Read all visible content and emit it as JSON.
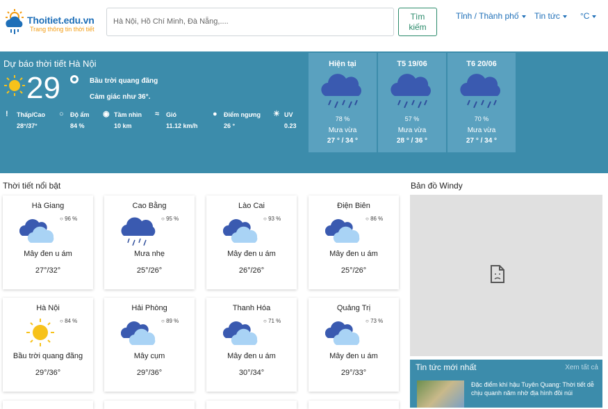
{
  "header": {
    "brand": "Thoitiet.edu.vn",
    "tagline": "Trang thông tin thời tiết",
    "search_placeholder": "Hà Nội, Hồ Chí Minh, Đà Nẵng,....",
    "search_button_line1": "Tìm",
    "search_button_line2": "kiếm",
    "nav_province": "Tỉnh / Thành phố",
    "nav_news": "Tin tức",
    "nav_unit": "°C"
  },
  "hero": {
    "title": "Dự báo thời tiết Hà Nội",
    "temp": "29",
    "desc": "Bầu trời quang đãng",
    "feel": "Cảm giác như 36°.",
    "stats": [
      {
        "label": "Thấp/Cao",
        "value": "28°/37°",
        "icon": "thermometer-icon"
      },
      {
        "label": "Độ ẩm",
        "value": "84 %",
        "icon": "droplet-icon"
      },
      {
        "label": "Tầm nhìn",
        "value": "10 km",
        "icon": "eye-icon"
      },
      {
        "label": "Gió",
        "value": "11.12 km/h",
        "icon": "wind-icon"
      },
      {
        "label": "Điểm ngưng",
        "value": "26 °",
        "icon": "dewpoint-icon"
      },
      {
        "label": "UV",
        "value": "0.23",
        "icon": "sun-small-icon"
      }
    ],
    "forecast": [
      {
        "day": "Hiện tại",
        "pct": "78 %",
        "desc": "Mưa vừa",
        "range": "27 ° / 34 °"
      },
      {
        "day": "T5 19/06",
        "pct": "57 %",
        "desc": "Mưa vừa",
        "range": "28 ° / 36 °"
      },
      {
        "day": "T6 20/06",
        "pct": "70 %",
        "desc": "Mưa vừa",
        "range": "27 ° / 34 °"
      }
    ]
  },
  "featured": {
    "title": "Thời tiết nổi bật",
    "cards": [
      {
        "city": "Hà Giang",
        "hum": "96 %",
        "desc": "Mây đen u ám",
        "range": "27°/32°",
        "icon": "overcast-icon"
      },
      {
        "city": "Cao Bằng",
        "hum": "95 %",
        "desc": "Mưa nhẹ",
        "range": "25°/26°",
        "icon": "light-rain-icon"
      },
      {
        "city": "Lào Cai",
        "hum": "93 %",
        "desc": "Mây đen u ám",
        "range": "26°/26°",
        "icon": "overcast-icon"
      },
      {
        "city": "Điện Biên",
        "hum": "86 %",
        "desc": "Mây đen u ám",
        "range": "25°/26°",
        "icon": "overcast-icon"
      },
      {
        "city": "Hà Nội",
        "hum": "84 %",
        "desc": "Bầu trời quang đãng",
        "range": "29°/36°",
        "icon": "sun-icon"
      },
      {
        "city": "Hải Phòng",
        "hum": "89 %",
        "desc": "Mây cụm",
        "range": "29°/36°",
        "icon": "overcast-icon"
      },
      {
        "city": "Thanh Hóa",
        "hum": "71 %",
        "desc": "Mây đen u ám",
        "range": "30°/34°",
        "icon": "overcast-icon"
      },
      {
        "city": "Quảng Trị",
        "hum": "73 %",
        "desc": "Mây đen u ám",
        "range": "29°/33°",
        "icon": "overcast-icon"
      }
    ]
  },
  "map": {
    "title": "Bản đồ Windy"
  },
  "news": {
    "title": "Tin tức mới nhất",
    "more": "Xem tất cả",
    "headline": "Đặc điểm khí hậu Tuyên Quang: Thời tiết dễ chịu quanh năm nhờ địa hình đồi núi"
  }
}
